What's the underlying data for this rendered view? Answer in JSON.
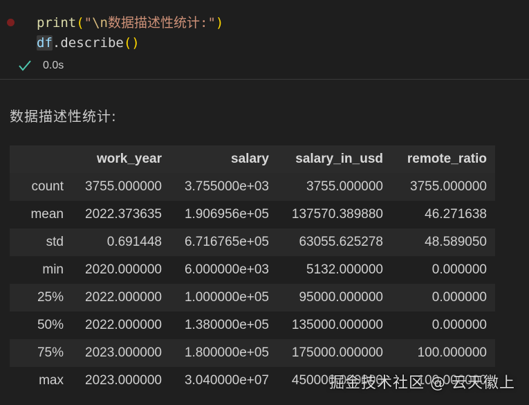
{
  "code": {
    "line1": {
      "fn": "print",
      "open_paren": "(",
      "quote_open": "\"",
      "escape": "\\n",
      "text": "数据描述性统计:",
      "quote_close": "\"",
      "close_paren": ")"
    },
    "line2": {
      "var": "df",
      "rest": ".describe",
      "parens": "()"
    }
  },
  "status": {
    "time": "0.0s",
    "icon": "check-icon",
    "success_color": "#4ec9b0"
  },
  "output": {
    "printed_text": "数据描述性统计:",
    "table": {
      "columns": [
        "",
        "work_year",
        "salary",
        "salary_in_usd",
        "remote_ratio"
      ],
      "rows": [
        {
          "index": "count",
          "values": [
            "3755.000000",
            "3.755000e+03",
            "3755.000000",
            "3755.000000"
          ]
        },
        {
          "index": "mean",
          "values": [
            "2022.373635",
            "1.906956e+05",
            "137570.389880",
            "46.271638"
          ]
        },
        {
          "index": "std",
          "values": [
            "0.691448",
            "6.716765e+05",
            "63055.625278",
            "48.589050"
          ]
        },
        {
          "index": "min",
          "values": [
            "2020.000000",
            "6.000000e+03",
            "5132.000000",
            "0.000000"
          ]
        },
        {
          "index": "25%",
          "values": [
            "2022.000000",
            "1.000000e+05",
            "95000.000000",
            "0.000000"
          ]
        },
        {
          "index": "50%",
          "values": [
            "2022.000000",
            "1.380000e+05",
            "135000.000000",
            "0.000000"
          ]
        },
        {
          "index": "75%",
          "values": [
            "2023.000000",
            "1.800000e+05",
            "175000.000000",
            "100.000000"
          ]
        },
        {
          "index": "max",
          "values": [
            "2023.000000",
            "3.040000e+07",
            "450000.000000",
            "100.000000"
          ]
        }
      ]
    }
  },
  "watermark": "掘金技术社区 @ 云天徽上"
}
